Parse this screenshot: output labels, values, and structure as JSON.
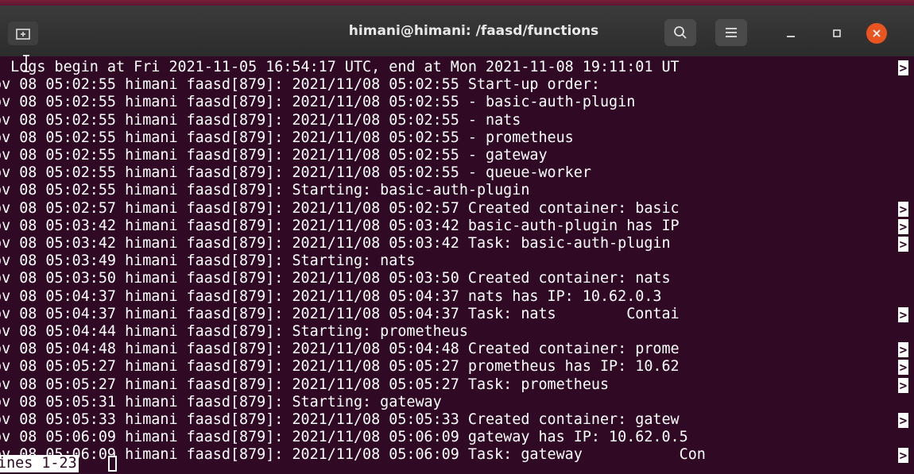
{
  "window": {
    "title": "himani@himani: /faasd/functions",
    "icons": {
      "new_tab": "new-tab-icon",
      "search": "search-icon",
      "menu": "hamburger-menu-icon",
      "minimize": "minimize-icon",
      "maximize": "maximize-icon",
      "close": "close-icon"
    },
    "colors": {
      "terminal_bg": "#300a24",
      "titlebar_bg": "#2c2c2c",
      "close_button": "#e95420",
      "text": "#ffffff"
    }
  },
  "terminal": {
    "lines": [
      {
        "text": "- Logs begin at Fri 2021-11-05 16:54:17 UTC, end at Mon 2021-11-08 19:11:01 UT",
        "overflow": true
      },
      {
        "text": "ov 08 05:02:55 himani faasd[879]: 2021/11/08 05:02:55 Start-up order:",
        "overflow": false
      },
      {
        "text": "ov 08 05:02:55 himani faasd[879]: 2021/11/08 05:02:55 - basic-auth-plugin",
        "overflow": false
      },
      {
        "text": "ov 08 05:02:55 himani faasd[879]: 2021/11/08 05:02:55 - nats",
        "overflow": false
      },
      {
        "text": "ov 08 05:02:55 himani faasd[879]: 2021/11/08 05:02:55 - prometheus",
        "overflow": false
      },
      {
        "text": "ov 08 05:02:55 himani faasd[879]: 2021/11/08 05:02:55 - gateway",
        "overflow": false
      },
      {
        "text": "ov 08 05:02:55 himani faasd[879]: 2021/11/08 05:02:55 - queue-worker",
        "overflow": false
      },
      {
        "text": "ov 08 05:02:55 himani faasd[879]: Starting: basic-auth-plugin",
        "overflow": false
      },
      {
        "text": "ov 08 05:02:57 himani faasd[879]: 2021/11/08 05:02:57 Created container: basic",
        "overflow": true
      },
      {
        "text": "ov 08 05:03:42 himani faasd[879]: 2021/11/08 05:03:42 basic-auth-plugin has IP",
        "overflow": true
      },
      {
        "text": "ov 08 05:03:42 himani faasd[879]: 2021/11/08 05:03:42 Task: basic-auth-plugin ",
        "overflow": true
      },
      {
        "text": "ov 08 05:03:49 himani faasd[879]: Starting: nats",
        "overflow": false
      },
      {
        "text": "ov 08 05:03:50 himani faasd[879]: 2021/11/08 05:03:50 Created container: nats",
        "overflow": false
      },
      {
        "text": "ov 08 05:04:37 himani faasd[879]: 2021/11/08 05:04:37 nats has IP: 10.62.0.3",
        "overflow": false
      },
      {
        "text": "ov 08 05:04:37 himani faasd[879]: 2021/11/08 05:04:37 Task: nats        Contai",
        "overflow": true
      },
      {
        "text": "ov 08 05:04:44 himani faasd[879]: Starting: prometheus",
        "overflow": false
      },
      {
        "text": "ov 08 05:04:48 himani faasd[879]: 2021/11/08 05:04:48 Created container: prome",
        "overflow": true
      },
      {
        "text": "ov 08 05:05:27 himani faasd[879]: 2021/11/08 05:05:27 prometheus has IP: 10.62",
        "overflow": true
      },
      {
        "text": "ov 08 05:05:27 himani faasd[879]: 2021/11/08 05:05:27 Task: prometheus",
        "overflow": true
      },
      {
        "text": "ov 08 05:05:31 himani faasd[879]: Starting: gateway",
        "overflow": false
      },
      {
        "text": "ov 08 05:05:33 himani faasd[879]: 2021/11/08 05:05:33 Created container: gatew",
        "overflow": true
      },
      {
        "text": "ov 08 05:06:09 himani faasd[879]: 2021/11/08 05:06:09 gateway has IP: 10.62.0.5",
        "overflow": false
      },
      {
        "text": "ov 08 05:06:09 himani faasd[879]: 2021/11/08 05:06:09 Task: gateway           Con",
        "overflow": true
      }
    ],
    "overflow_glyph": ">",
    "status": "ines 1-23"
  }
}
